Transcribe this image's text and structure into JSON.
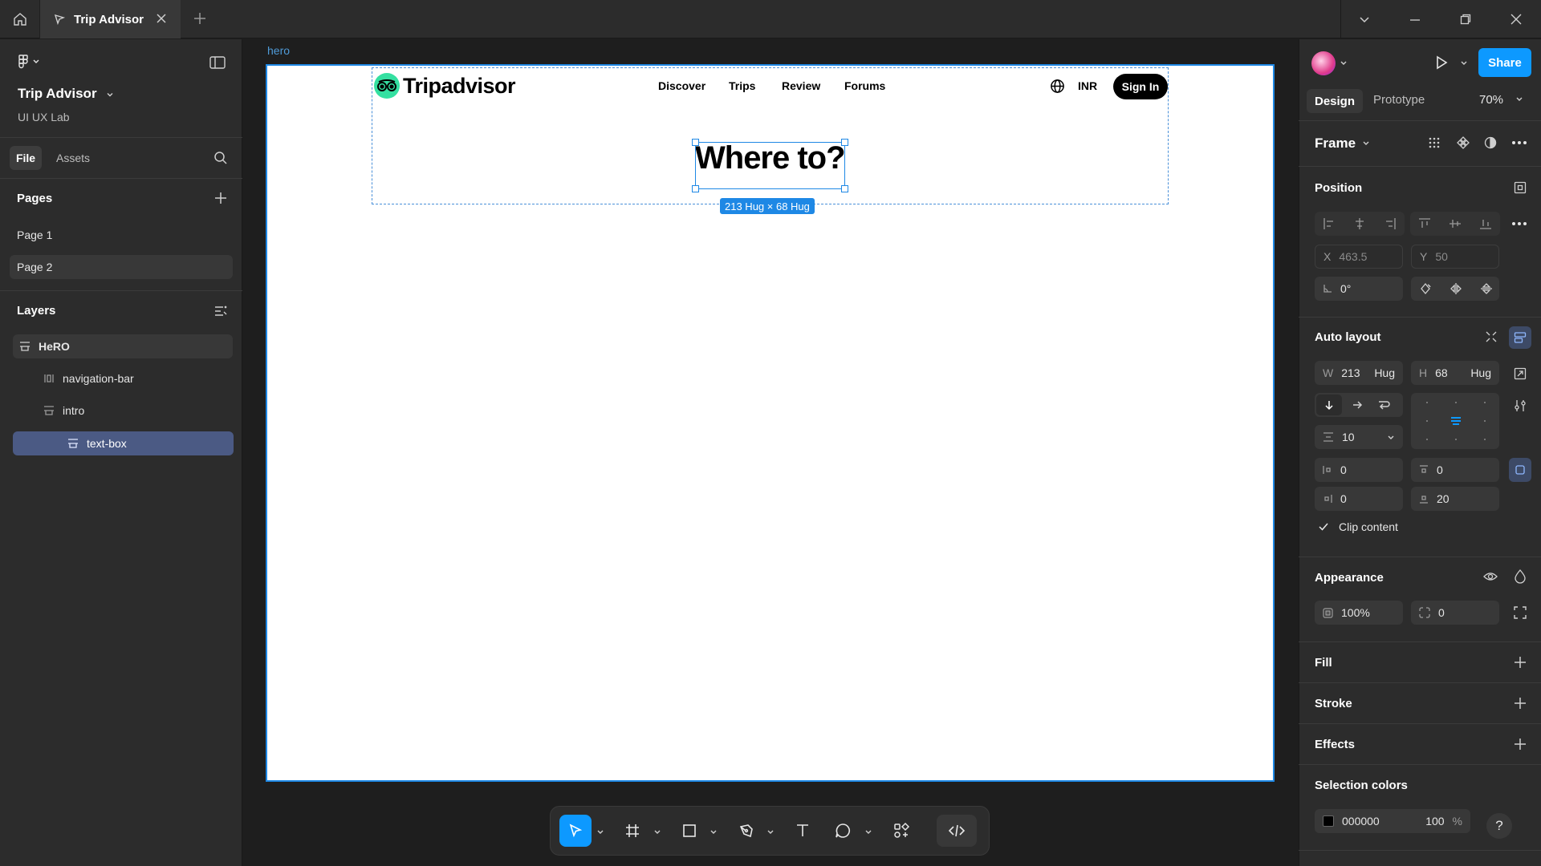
{
  "titlebar": {
    "tab_label": "Trip Advisor",
    "icons": [
      "home-icon",
      "figma-file-icon",
      "close-icon",
      "plus-icon",
      "chevron-down-icon",
      "minimize-icon",
      "restore-icon",
      "close-window-icon"
    ]
  },
  "left_panel": {
    "file_name": "Trip Advisor",
    "team_name": "UI UX Lab",
    "tabs": [
      "File",
      "Assets"
    ],
    "pages_title": "Pages",
    "pages": [
      {
        "label": "Page 1",
        "active": false
      },
      {
        "label": "Page 2",
        "active": true
      }
    ],
    "layers_title": "Layers",
    "layers": [
      {
        "label": "HeRO",
        "depth": 0,
        "selected": false
      },
      {
        "label": "navigation-bar",
        "depth": 1,
        "selected": false
      },
      {
        "label": "intro",
        "depth": 1,
        "selected": false
      },
      {
        "label": "text-box",
        "depth": 2,
        "selected": true
      }
    ]
  },
  "canvas": {
    "frame_label": "hero",
    "site": {
      "logo_text": "Tripadvisor",
      "nav_links": [
        "Discover",
        "Trips",
        "Review",
        "Forums"
      ],
      "currency": "INR",
      "sign_in": "Sign In",
      "heading": "Where to?"
    },
    "selection_size": "213 Hug × 68 Hug"
  },
  "toolbar": {
    "tools": [
      "move-tool",
      "frame-tool",
      "rectangle-tool",
      "pen-tool",
      "text-tool",
      "comment-tool",
      "actions-tool",
      "dev-mode-tool"
    ],
    "active_tool": "move-tool"
  },
  "right_panel": {
    "share_label": "Share",
    "tabs": [
      "Design",
      "Prototype"
    ],
    "zoom": "70%",
    "frame_type": "Frame",
    "position": {
      "title": "Position",
      "x_label": "X",
      "x": "463.5",
      "y_label": "Y",
      "y": "50",
      "rotation": "0°"
    },
    "auto_layout": {
      "title": "Auto layout",
      "w_label": "W",
      "w": "213",
      "w_mode": "Hug",
      "h_label": "H",
      "h": "68",
      "h_mode": "Hug",
      "gap": "10",
      "padding_left": "0",
      "padding_top": "0",
      "padding_right": "0",
      "padding_bottom": "20",
      "clip_content": "Clip content"
    },
    "appearance": {
      "title": "Appearance",
      "opacity": "100%",
      "radius": "0"
    },
    "fill_title": "Fill",
    "stroke_title": "Stroke",
    "effects_title": "Effects",
    "selection_colors": {
      "title": "Selection colors",
      "hex": "000000",
      "opacity": "100",
      "percent": "%",
      "swatch_color": "#000000"
    },
    "help_label": "?"
  },
  "colors": {
    "accent": "#0d99ff",
    "selection": "#1e88e5",
    "layer_selected": "#4b5a84",
    "logo_green": "#34e0a1"
  }
}
